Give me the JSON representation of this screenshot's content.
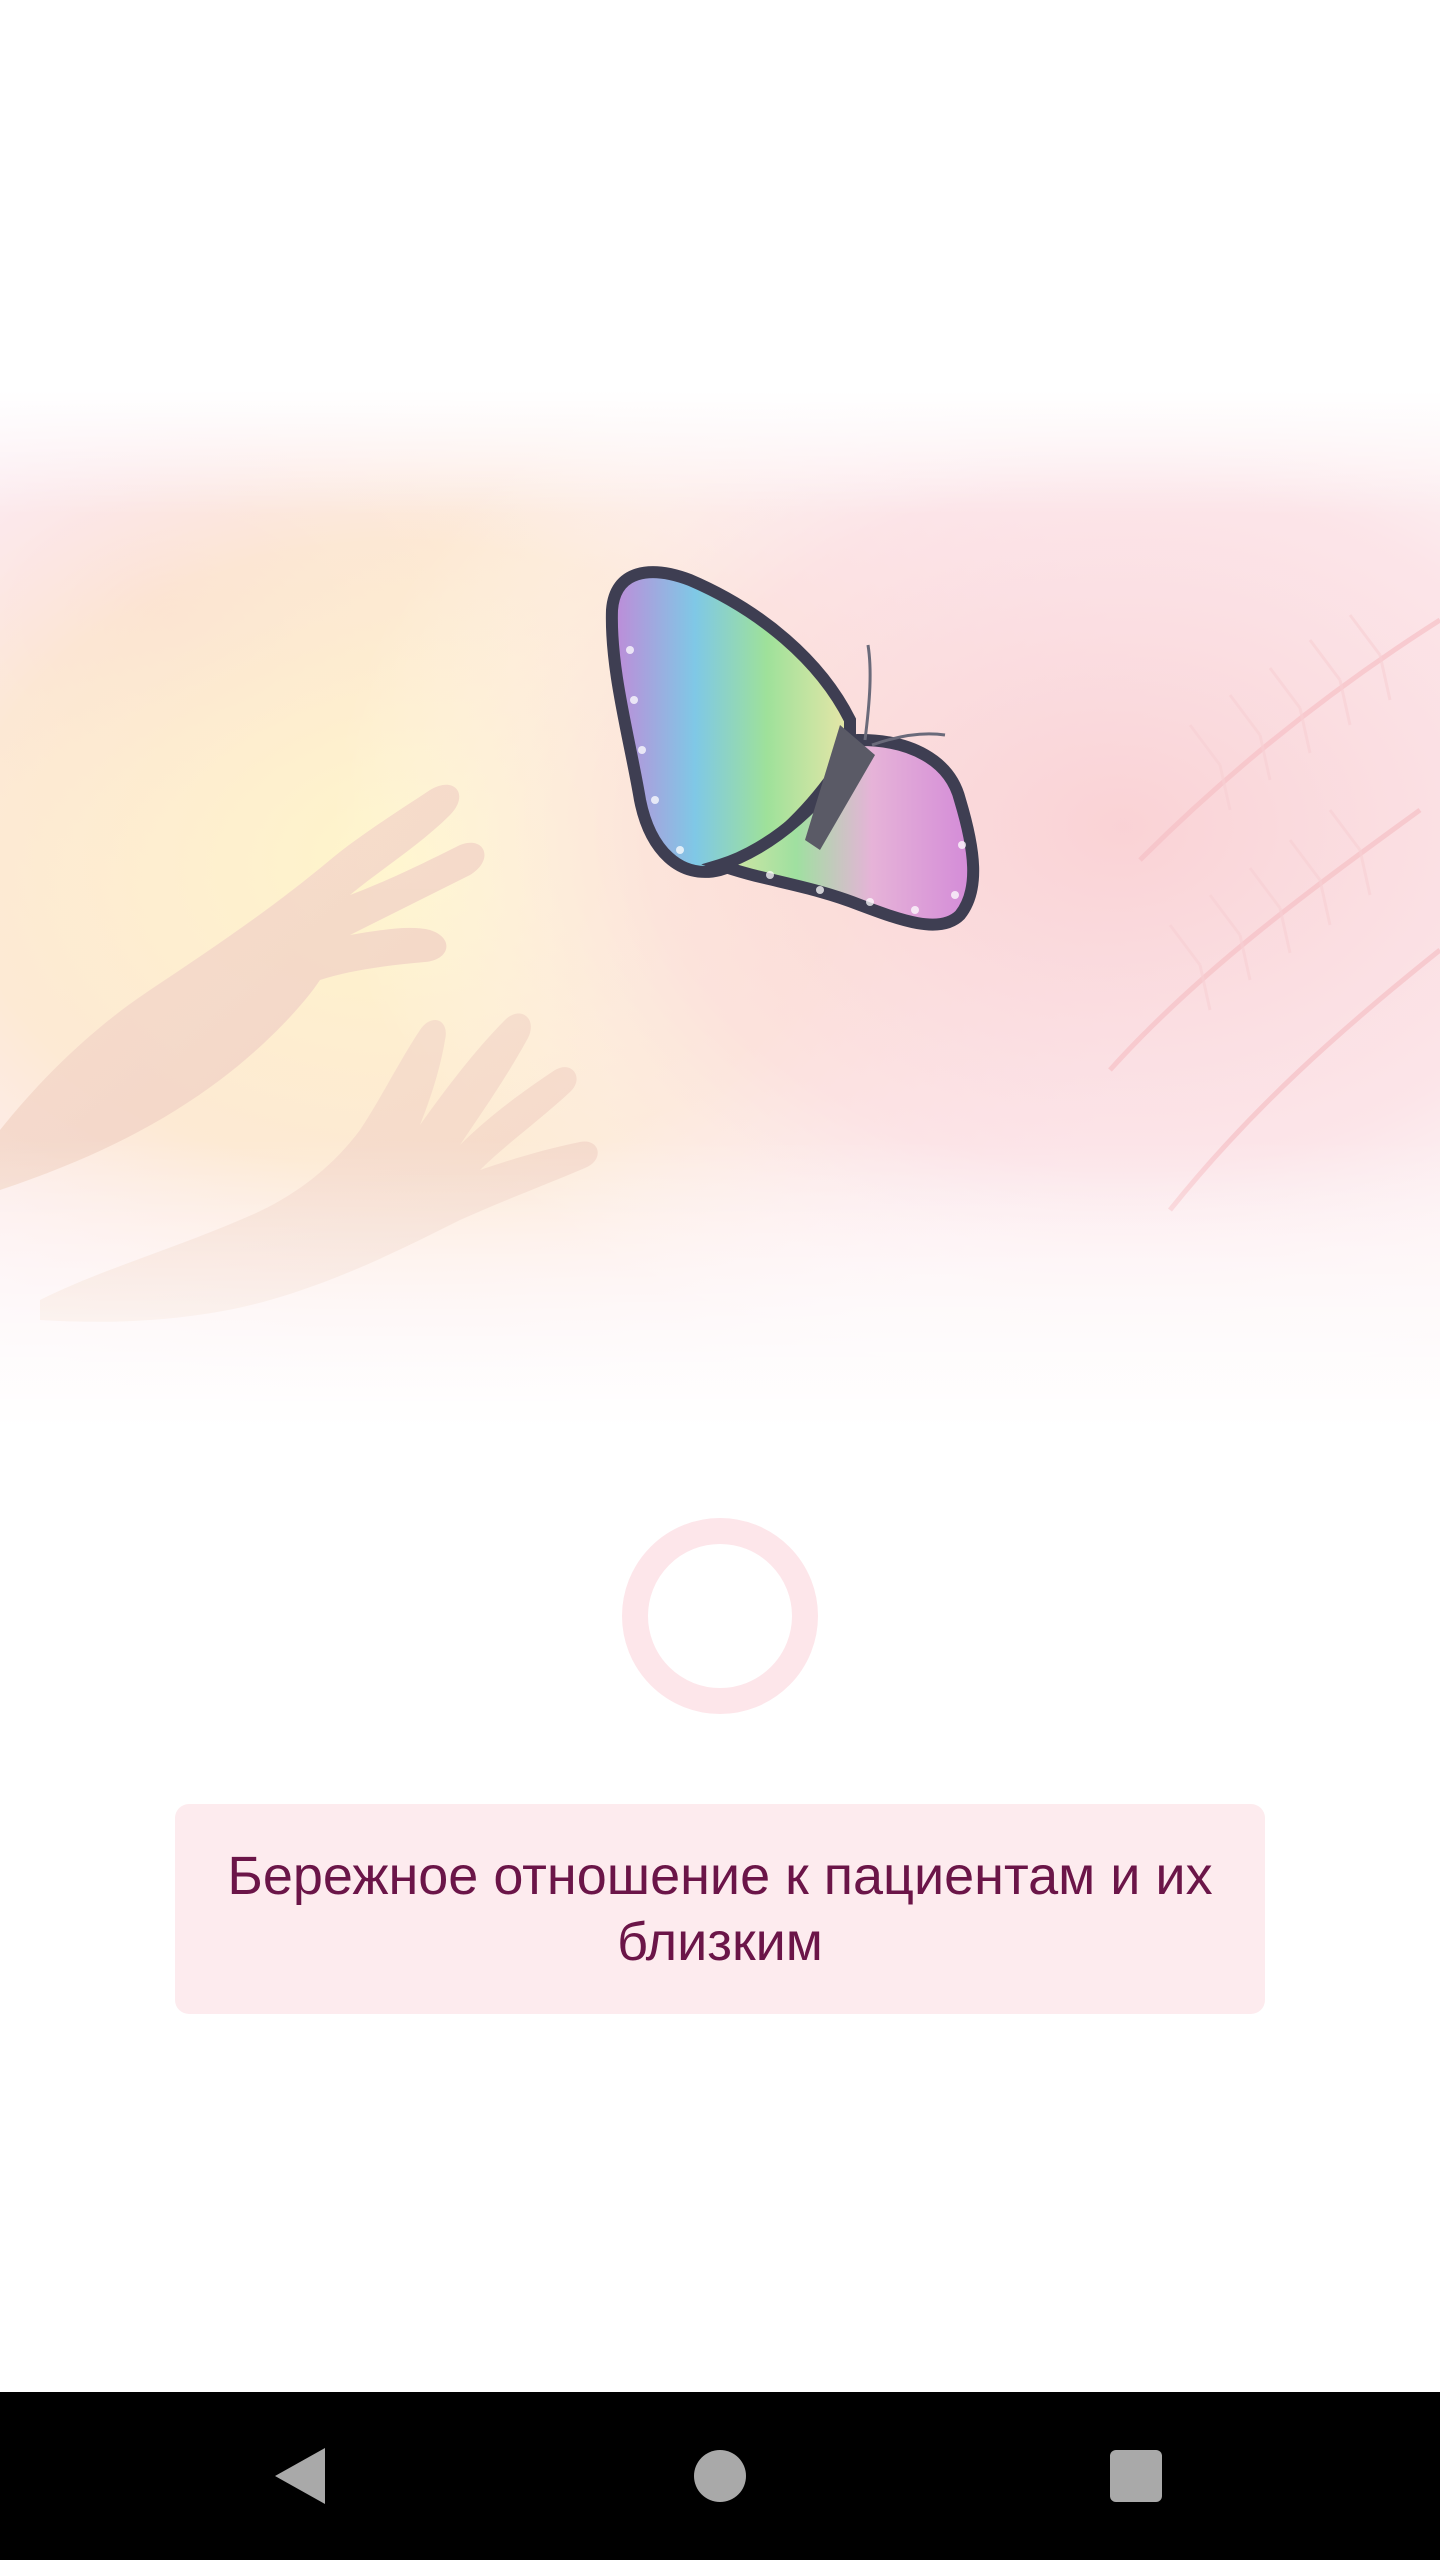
{
  "splash": {
    "hero_image": "hands-releasing-butterfly",
    "loading_indicator": "circular-progress",
    "tagline": "Бережное отношение к пациентам и их близким"
  },
  "navigation_bar": {
    "back": "back-icon",
    "home": "home-icon",
    "recents": "recents-icon"
  },
  "colors": {
    "background": "#ffffff",
    "caption_background": "#fdebee",
    "caption_text": "#6b1548",
    "spinner": "#fde6ea",
    "nav_bar": "#000000",
    "nav_icon": "#a9a9a9"
  }
}
